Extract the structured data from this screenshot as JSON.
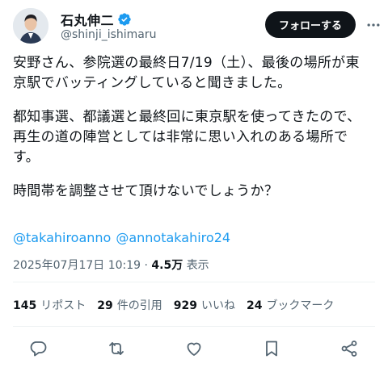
{
  "user": {
    "display_name": "石丸伸二",
    "handle": "@shinji_ishimaru",
    "verified_icon": "verified-badge-icon",
    "accent_color": "#1d9bf0"
  },
  "header": {
    "follow_label": "フォローする",
    "more_icon": "more-icon"
  },
  "tweet": {
    "paragraphs": [
      [
        "安野さん、参院選の最終日7/19（土）、最後の場所が東",
        "京駅でバッティングしていると聞きました。"
      ],
      [
        "都知事選、都議選と最終回に東京駅を使ってきたので、",
        "再生の道の陣営としては非常に思い入れのある場所で",
        "す。"
      ],
      [
        "時間帯を調整させて頂けないでしょうか？"
      ]
    ],
    "mentions": [
      "@takahiroanno",
      "@annotakahiro24"
    ]
  },
  "meta": {
    "timestamp": "2025年07月17日 10:19",
    "separator": "·",
    "views": "4.5万",
    "views_label": "表示"
  },
  "stats": [
    {
      "count": "145",
      "label": "リポスト"
    },
    {
      "count": "29",
      "label": "件の引用"
    },
    {
      "count": "929",
      "label": "いいね"
    },
    {
      "count": "24",
      "label": "ブックマーク"
    }
  ],
  "actions": [
    "reply-icon",
    "retweet-icon",
    "like-icon",
    "bookmark-icon",
    "share-icon"
  ]
}
